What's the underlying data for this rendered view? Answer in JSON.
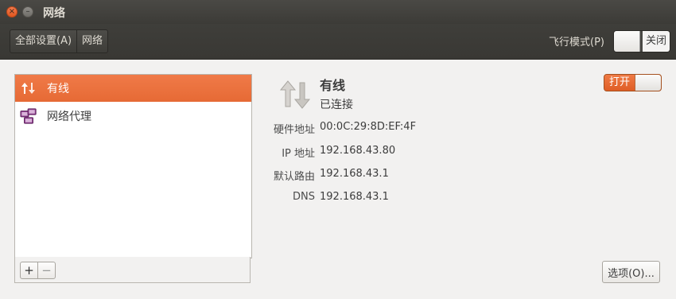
{
  "window": {
    "title": "网络",
    "close_glyph": "×",
    "min_glyph": "–"
  },
  "toolbar": {
    "breadcrumbs": [
      "全部设置(A)",
      "网络"
    ],
    "airplane_label": "飞行模式(P)",
    "airplane_state": "关闭"
  },
  "list": {
    "items": [
      {
        "label": "有线",
        "icon": "wired-arrows-icon",
        "selected": true
      },
      {
        "label": "网络代理",
        "icon": "network-proxy-icon",
        "selected": false
      }
    ],
    "add_glyph": "+",
    "remove_glyph": "−"
  },
  "detail": {
    "name": "有线",
    "status": "已连接",
    "switch_label": "打开",
    "rows": [
      {
        "key": "硬件地址",
        "value": "00:0C:29:8D:EF:4F"
      },
      {
        "key": "IP 地址",
        "value": "192.168.43.80"
      },
      {
        "key": "默认路由",
        "value": "192.168.43.1"
      },
      {
        "key": "DNS",
        "value": "192.168.43.1"
      }
    ],
    "options_label": "选项(O)..."
  },
  "colors": {
    "accent": "#e7662f",
    "titlebar": "#3c3b37",
    "background": "#f2f1f0"
  }
}
